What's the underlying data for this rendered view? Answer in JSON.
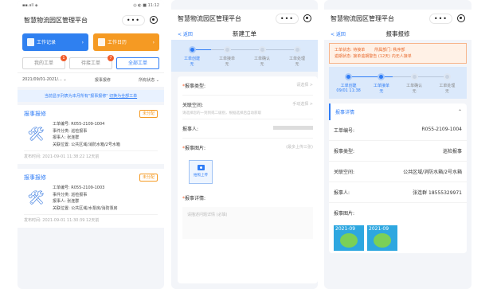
{
  "app_title": "智慧物流园区管理平台",
  "screen1": {
    "status_left": "▪▪.all ◈",
    "status_right": "◎ ◐ ■ 11:12",
    "quick": [
      "工作记录",
      "工作日历"
    ],
    "tabs": [
      {
        "label": "我的工单",
        "badge": "1"
      },
      {
        "label": "待接工单",
        "badge": "7"
      },
      {
        "label": "全部工单",
        "badge": ""
      }
    ],
    "filters": [
      "2021/09/01-2021/... ⌄",
      "报事报修",
      "所有状态 ⌄"
    ],
    "notice": "当前显示列表为本月所有\"报事报修\"",
    "notice_link": "切换为全部工单",
    "cards": [
      {
        "title": "报事报修",
        "status": "未分配",
        "fields": [
          "工单编号: R055-2109-1004",
          "事件分类: 巡检报事",
          "报事人: 张连群",
          "关联位置: 公共区域/消防水箱/2号水箱"
        ],
        "time": "发布时间: 2021-09-01 11:38:22 12天前"
      },
      {
        "title": "报事报修",
        "status": "未分配",
        "fields": [
          "工单编号: R055-2109-1003",
          "事件分类: 巡检报事",
          "报事人: 张连群",
          "关联位置: 公共区域/水泵房/消防泵房"
        ],
        "time": "发布时间: 2021-09-01 11:30:39 12天前"
      }
    ]
  },
  "screen2": {
    "back": "< 返回",
    "title": "新建工单",
    "steps": [
      "工单创建\n无",
      "工单接单\n无",
      "工单确认\n无",
      "工单处理\n无"
    ],
    "form": [
      {
        "label": "报事类型:",
        "value": "请选择 >",
        "req": true
      },
      {
        "label": "关联空间:",
        "value": "手动选择 >",
        "req": false
      }
    ],
    "hint": "请选择您的一到到或二级别，根据选择后自动获取",
    "reporter_label": "报事人:",
    "image_label": "报事图片:",
    "image_hint": "(最多上传三张)",
    "upload": "拍照上传",
    "desc_label": "报事详情:",
    "desc_placeholder": "请描述问题详情 (必填)"
  },
  "screen3": {
    "back": "< 返回",
    "title": "报事报修",
    "warn_row1": [
      "工单状态: 待接单",
      "所属部门: 秩序部"
    ],
    "warn_row2": "逾期状态: 接单逾期警告 (12天) 内无人接单",
    "steps": [
      "工单创建\n09/01 11:38",
      "工单接单\n无",
      "工单确认\n无",
      "工单处理\n无"
    ],
    "detail_title": "报事详情",
    "rows": [
      [
        "工单编号:",
        "R055-2109-1004"
      ],
      [
        "报事类型:",
        "巡检报事"
      ],
      [
        "关联空间:",
        "公共区域/消防水箱/2号水箱"
      ],
      [
        "报事人:",
        "张连群 18555329971"
      ]
    ],
    "image_label": "报事图片:",
    "thumb_labels": [
      "2021-09",
      "2021-09"
    ]
  }
}
